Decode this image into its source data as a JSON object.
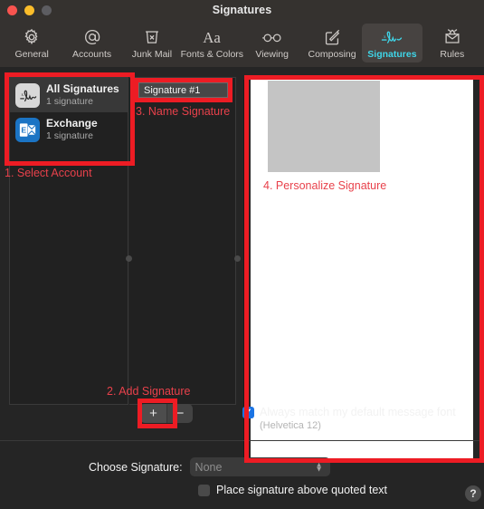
{
  "window": {
    "title": "Signatures",
    "traffic_lights": [
      "close-red",
      "minimize-yellow",
      "zoom-gray"
    ]
  },
  "toolbar": {
    "items": [
      {
        "label": "General",
        "icon": "gear-icon",
        "active": false
      },
      {
        "label": "Accounts",
        "icon": "at-sign-icon",
        "active": false
      },
      {
        "label": "Junk Mail",
        "icon": "trash-x-icon",
        "active": false
      },
      {
        "label": "Fonts & Colors",
        "icon": "aa-text-icon",
        "active": false
      },
      {
        "label": "Viewing",
        "icon": "glasses-icon",
        "active": false
      },
      {
        "label": "Composing",
        "icon": "compose-pencil-icon",
        "active": false
      },
      {
        "label": "Signatures",
        "icon": "signature-icon",
        "active": true
      },
      {
        "label": "Rules",
        "icon": "envelope-rules-icon",
        "active": false
      }
    ],
    "active_accent": "#3fd5e8"
  },
  "accounts": {
    "items": [
      {
        "name": "All Signatures",
        "subtitle": "1 signature",
        "icon": "signature-thumb-icon",
        "selected": true
      },
      {
        "name": "Exchange",
        "subtitle": "1 signature",
        "icon": "exchange-app-icon",
        "selected": false
      }
    ]
  },
  "signature_list": {
    "name_field_value": "Signature #1",
    "add_button_label": "+",
    "remove_button_label": "−"
  },
  "editor": {
    "image_placeholder": "signature-image-placeholder"
  },
  "options": {
    "always_match_label": "Always match my default message font",
    "always_match_sub": "(Helvetica 12)",
    "always_match_checked": true,
    "choose_signature_label": "Choose Signature:",
    "choose_signature_value": "None",
    "place_above_label": "Place signature above quoted text",
    "place_above_checked": false,
    "help_label": "?"
  },
  "annotations": {
    "color": "#ed1c24",
    "text_color": "#e8414b",
    "steps": [
      {
        "id": "select-account",
        "text": "1. Select Account"
      },
      {
        "id": "add-signature",
        "text": "2. Add Signature"
      },
      {
        "id": "name-signature",
        "text": "3. Name Signature"
      },
      {
        "id": "personalize-signature",
        "text": "4. Personalize Signature"
      }
    ]
  }
}
